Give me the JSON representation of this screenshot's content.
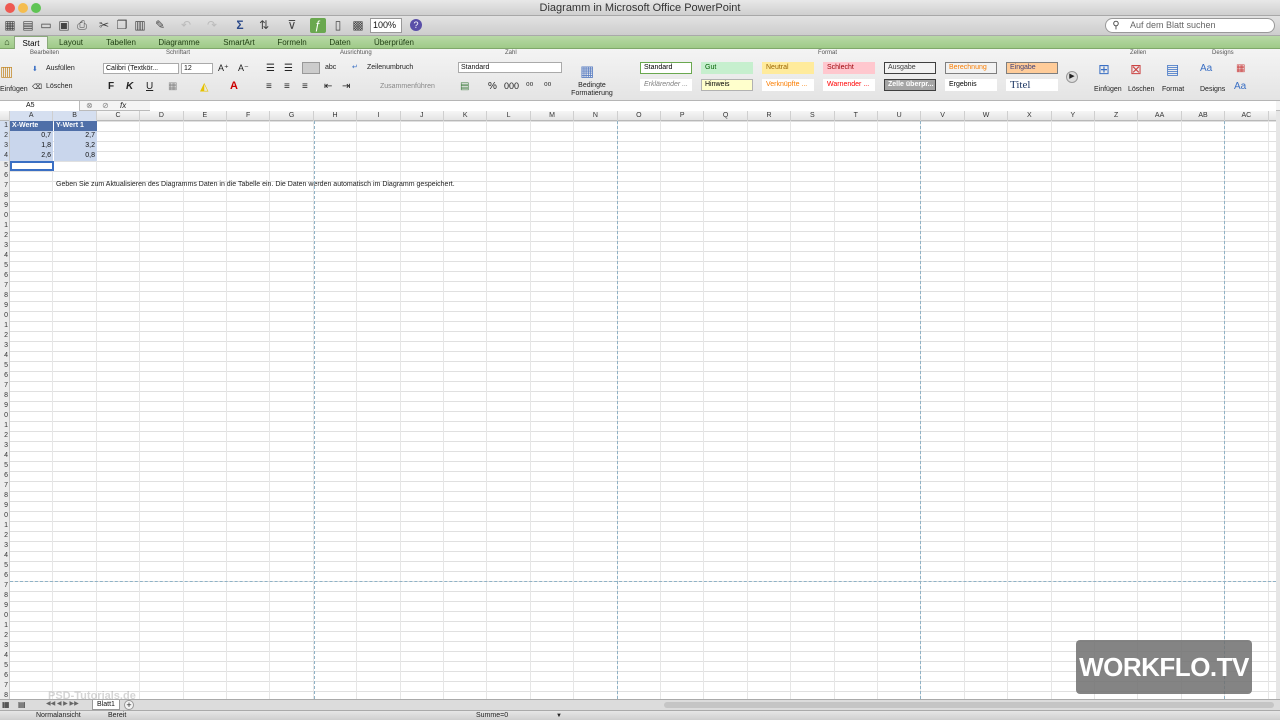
{
  "window": {
    "title": "Diagramm in Microsoft Office PowerPoint"
  },
  "toolbar": {
    "zoom": "100%",
    "search_placeholder": "Auf dem Blatt suchen"
  },
  "tabs": [
    {
      "label": "Start",
      "active": true
    },
    {
      "label": "Layout"
    },
    {
      "label": "Tabellen"
    },
    {
      "label": "Diagramme"
    },
    {
      "label": "SmartArt"
    },
    {
      "label": "Formeln"
    },
    {
      "label": "Daten"
    },
    {
      "label": "Überprüfen"
    }
  ],
  "ribbon": {
    "groups": [
      "Bearbeiten",
      "Schriftart",
      "Ausrichtung",
      "Zahl",
      "Format",
      "Zellen",
      "Designs"
    ],
    "edit": {
      "fill": "Ausfüllen",
      "clear": "Löschen",
      "paste": "Einfügen"
    },
    "font": {
      "name": "Calibri (Textkör...",
      "size": "12",
      "bold": "F",
      "italic": "K",
      "underline": "U"
    },
    "align": {
      "wrap": "Zeilenumbruch",
      "merge": "Zusammenführen",
      "abc": "abc"
    },
    "number": {
      "format": "Standard",
      "percent": "%",
      "thousands": "000"
    },
    "conditional": "Bedingte Formatierung",
    "styles": [
      {
        "label": "Standard",
        "bg": "#ffffff",
        "border": "#6aa84f",
        "color": "#000000"
      },
      {
        "label": "Gut",
        "bg": "#c6efce",
        "border": "#c6efce",
        "color": "#006100"
      },
      {
        "label": "Neutral",
        "bg": "#ffeb9c",
        "border": "#ffeb9c",
        "color": "#9c6500"
      },
      {
        "label": "Schlecht",
        "bg": "#ffc7ce",
        "border": "#ffc7ce",
        "color": "#9c0006"
      },
      {
        "label": "Ausgabe",
        "bg": "#f2f2f2",
        "border": "#3f3f3f",
        "color": "#3f3f3f"
      },
      {
        "label": "Berechnung",
        "bg": "#f2f2f2",
        "border": "#7f7f7f",
        "color": "#fa7d00"
      },
      {
        "label": "Eingabe",
        "bg": "#ffcc99",
        "border": "#7f7f7f",
        "color": "#3f3f76"
      },
      {
        "label": "Erklärender ...",
        "bg": "#ffffff",
        "border": "#ffffff",
        "color": "#7f7f7f"
      },
      {
        "label": "Hinweis",
        "bg": "#ffffcc",
        "border": "#b2b2b2",
        "color": "#000000"
      },
      {
        "label": "Verknüpfte ...",
        "bg": "#ffffff",
        "border": "#ffffff",
        "color": "#fa7d00"
      },
      {
        "label": "Warnender ...",
        "bg": "#ffffff",
        "border": "#ffffff",
        "color": "#ff0000"
      },
      {
        "label": "Zelle überpr...",
        "bg": "#a5a5a5",
        "border": "#3f3f3f",
        "color": "#ffffff"
      },
      {
        "label": "Ergebnis",
        "bg": "#ffffff",
        "border": "#ffffff",
        "color": "#000000"
      },
      {
        "label": "Titel",
        "bg": "#ffffff",
        "border": "#ffffff",
        "color": "#1f3864"
      }
    ],
    "cells": {
      "insert": "Einfügen",
      "delete": "Löschen",
      "format": "Format"
    },
    "designs": {
      "label": "Designs",
      "aa": "Aa"
    }
  },
  "formula_bar": {
    "cell_ref": "A5",
    "fx": "fx",
    "content": ""
  },
  "columns": [
    "A",
    "B",
    "C",
    "D",
    "E",
    "F",
    "G",
    "H",
    "I",
    "J",
    "K",
    "L",
    "M",
    "N",
    "O",
    "P",
    "Q",
    "R",
    "S",
    "T",
    "U",
    "V",
    "W",
    "X",
    "Y",
    "Z",
    "AA",
    "AB",
    "AC"
  ],
  "table": {
    "headers": [
      "X-Werte",
      "Y-Wert 1"
    ],
    "rows": [
      [
        "0,7",
        "2,7"
      ],
      [
        "1,8",
        "3,2"
      ],
      [
        "2,6",
        "0,8"
      ]
    ]
  },
  "note": "Geben Sie zum Aktualisieren des Diagramms Daten in die Tabelle ein. Die Daten werden automatisch im Diagramm gespeichert.",
  "sheet": {
    "tab": "Blatt1",
    "add": "+"
  },
  "status": {
    "view": "Normalansicht",
    "ready": "Bereit",
    "sum": "Summe=0"
  },
  "watermark": "WORKFLO.TV",
  "watermark_small": "PSD-Tutorials.de"
}
